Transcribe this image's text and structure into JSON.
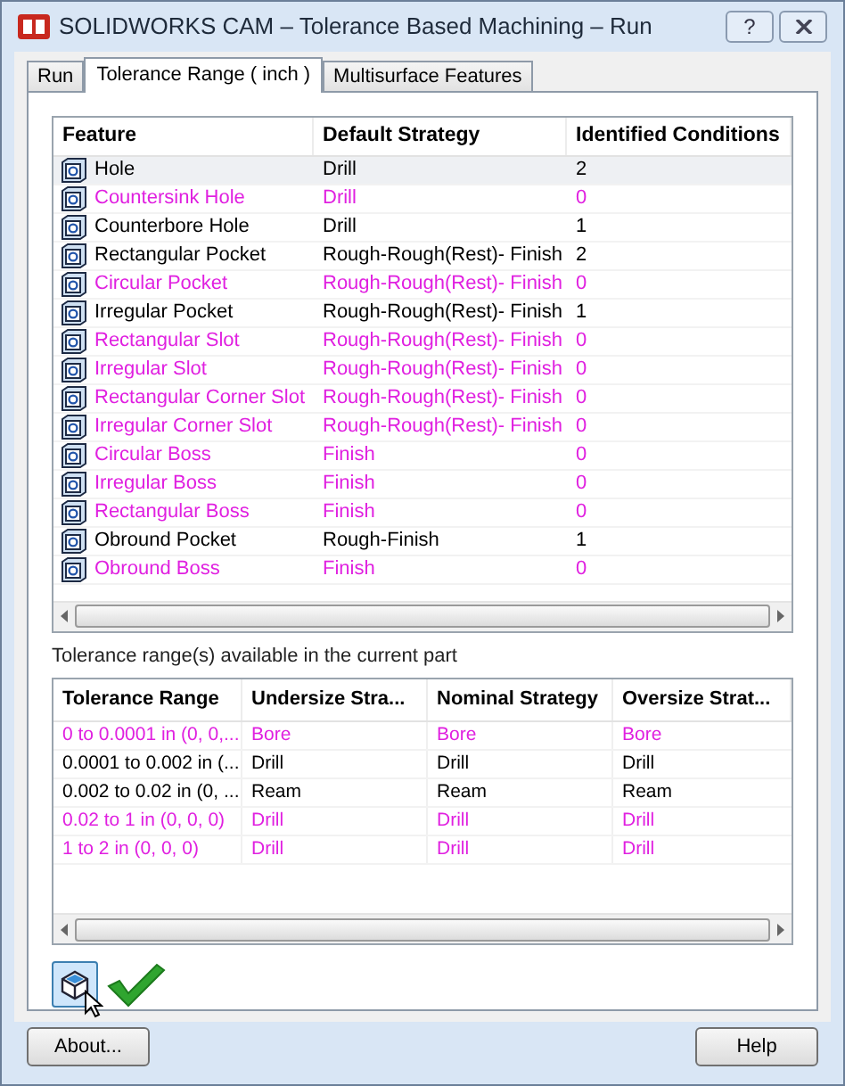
{
  "window": {
    "title": "SOLIDWORKS CAM – Tolerance Based Machining – Run",
    "help_button": "?"
  },
  "tabs": [
    {
      "label": "Run",
      "selected": false
    },
    {
      "label": "Tolerance Range ( inch )",
      "selected": true
    },
    {
      "label": "Multisurface Features",
      "selected": false
    }
  ],
  "feature_table": {
    "columns": [
      "Feature",
      "Default Strategy",
      "Identified Conditions"
    ],
    "rows": [
      {
        "feature": "Hole",
        "strategy": "Drill",
        "conditions": "2",
        "color": "#000000",
        "selected": true
      },
      {
        "feature": "Countersink Hole",
        "strategy": "Drill",
        "conditions": "0",
        "color": "#e020e0",
        "selected": false
      },
      {
        "feature": "Counterbore Hole",
        "strategy": "Drill",
        "conditions": "1",
        "color": "#000000",
        "selected": false
      },
      {
        "feature": "Rectangular Pocket",
        "strategy": "Rough-Rough(Rest)- Finish",
        "conditions": "2",
        "color": "#000000",
        "selected": false
      },
      {
        "feature": "Circular Pocket",
        "strategy": "Rough-Rough(Rest)- Finish",
        "conditions": "0",
        "color": "#e020e0",
        "selected": false
      },
      {
        "feature": "Irregular Pocket",
        "strategy": "Rough-Rough(Rest)- Finish",
        "conditions": "1",
        "color": "#000000",
        "selected": false
      },
      {
        "feature": "Rectangular Slot",
        "strategy": "Rough-Rough(Rest)- Finish",
        "conditions": "0",
        "color": "#e020e0",
        "selected": false
      },
      {
        "feature": "Irregular Slot",
        "strategy": "Rough-Rough(Rest)- Finish",
        "conditions": "0",
        "color": "#e020e0",
        "selected": false
      },
      {
        "feature": "Rectangular Corner Slot",
        "strategy": "Rough-Rough(Rest)- Finish",
        "conditions": "0",
        "color": "#e020e0",
        "selected": false
      },
      {
        "feature": "Irregular Corner Slot",
        "strategy": "Rough-Rough(Rest)- Finish",
        "conditions": "0",
        "color": "#e020e0",
        "selected": false
      },
      {
        "feature": "Circular Boss",
        "strategy": "Finish",
        "conditions": "0",
        "color": "#e020e0",
        "selected": false
      },
      {
        "feature": "Irregular Boss",
        "strategy": "Finish",
        "conditions": "0",
        "color": "#e020e0",
        "selected": false
      },
      {
        "feature": "Rectangular Boss",
        "strategy": "Finish",
        "conditions": "0",
        "color": "#e020e0",
        "selected": false
      },
      {
        "feature": "Obround Pocket",
        "strategy": "Rough-Finish",
        "conditions": "1",
        "color": "#000000",
        "selected": false
      },
      {
        "feature": "Obround Boss",
        "strategy": "Finish",
        "conditions": "0",
        "color": "#e020e0",
        "selected": false
      }
    ]
  },
  "ranges_label": "Tolerance range(s) available in the current part",
  "range_table": {
    "columns": [
      "Tolerance Range",
      "Undersize Stra...",
      "Nominal Strategy",
      "Oversize Strat..."
    ],
    "rows": [
      {
        "cells": [
          "0 to 0.0001 in (0, 0,...",
          "Bore",
          "Bore",
          "Bore"
        ],
        "color": "#e020e0"
      },
      {
        "cells": [
          "0.0001 to 0.002 in (...",
          "Drill",
          "Drill",
          "Drill"
        ],
        "color": "#000000"
      },
      {
        "cells": [
          "0.002 to 0.02 in (0, ...",
          "Ream",
          "Ream",
          "Ream"
        ],
        "color": "#000000"
      },
      {
        "cells": [
          "0.02 to 1 in (0, 0, 0)",
          "Drill",
          "Drill",
          "Drill"
        ],
        "color": "#e020e0"
      },
      {
        "cells": [
          "1 to 2 in (0, 0, 0)",
          "Drill",
          "Drill",
          "Drill"
        ],
        "color": "#e020e0"
      }
    ]
  },
  "buttons": [
    "About...",
    "Help"
  ]
}
